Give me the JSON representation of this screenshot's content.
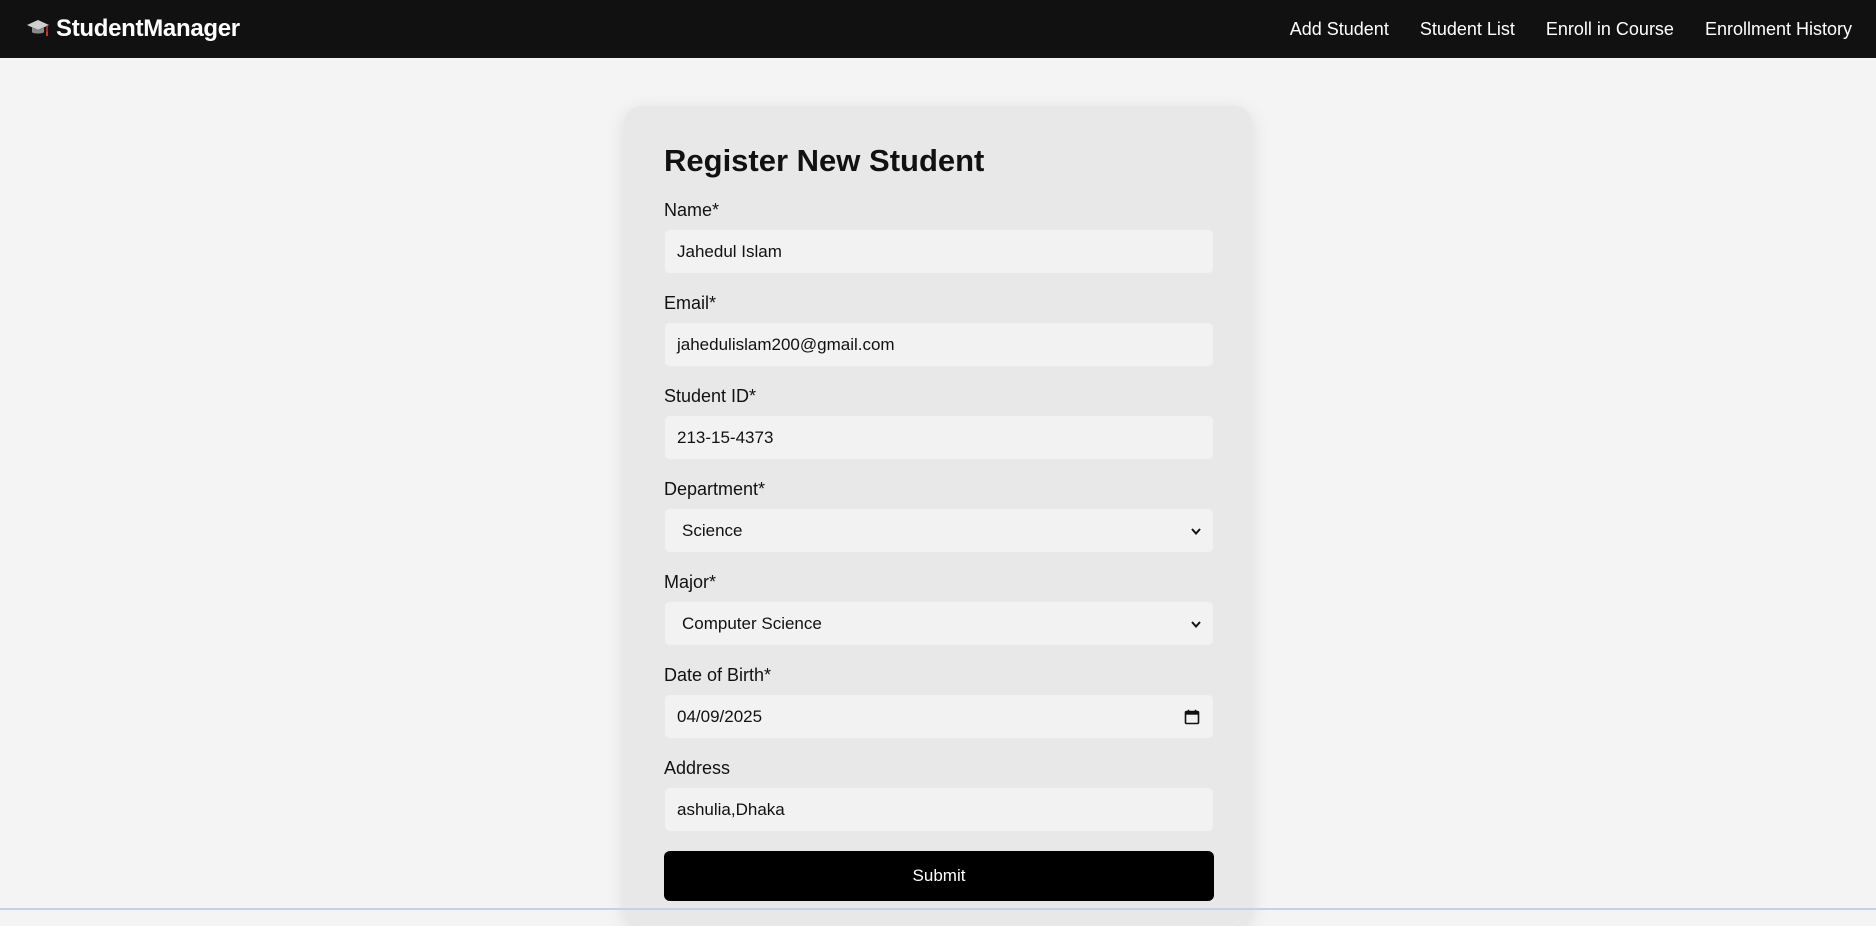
{
  "navbar": {
    "brand": "StudentManager",
    "brand_icon": "graduation-cap-icon",
    "links": [
      {
        "label": "Add Student"
      },
      {
        "label": "Student List"
      },
      {
        "label": "Enroll in Course"
      },
      {
        "label": "Enrollment History"
      }
    ]
  },
  "form": {
    "title": "Register New Student",
    "fields": {
      "name": {
        "label": "Name*",
        "value": "Jahedul Islam"
      },
      "email": {
        "label": "Email*",
        "value": "jahedulislam200@gmail.com"
      },
      "student_id": {
        "label": "Student ID*",
        "value": "213-15-4373"
      },
      "department": {
        "label": "Department*",
        "value": "Science"
      },
      "major": {
        "label": "Major*",
        "value": "Computer Science"
      },
      "dob": {
        "label": "Date of Birth*",
        "value": "04/09/2025"
      },
      "address": {
        "label": "Address",
        "value": "ashulia,Dhaka"
      }
    },
    "submit_label": "Submit"
  },
  "colors": {
    "navbar_bg": "#111111",
    "page_bg": "#f4f4f4",
    "card_bg": "#e8e8e8",
    "button_bg": "#000000"
  }
}
